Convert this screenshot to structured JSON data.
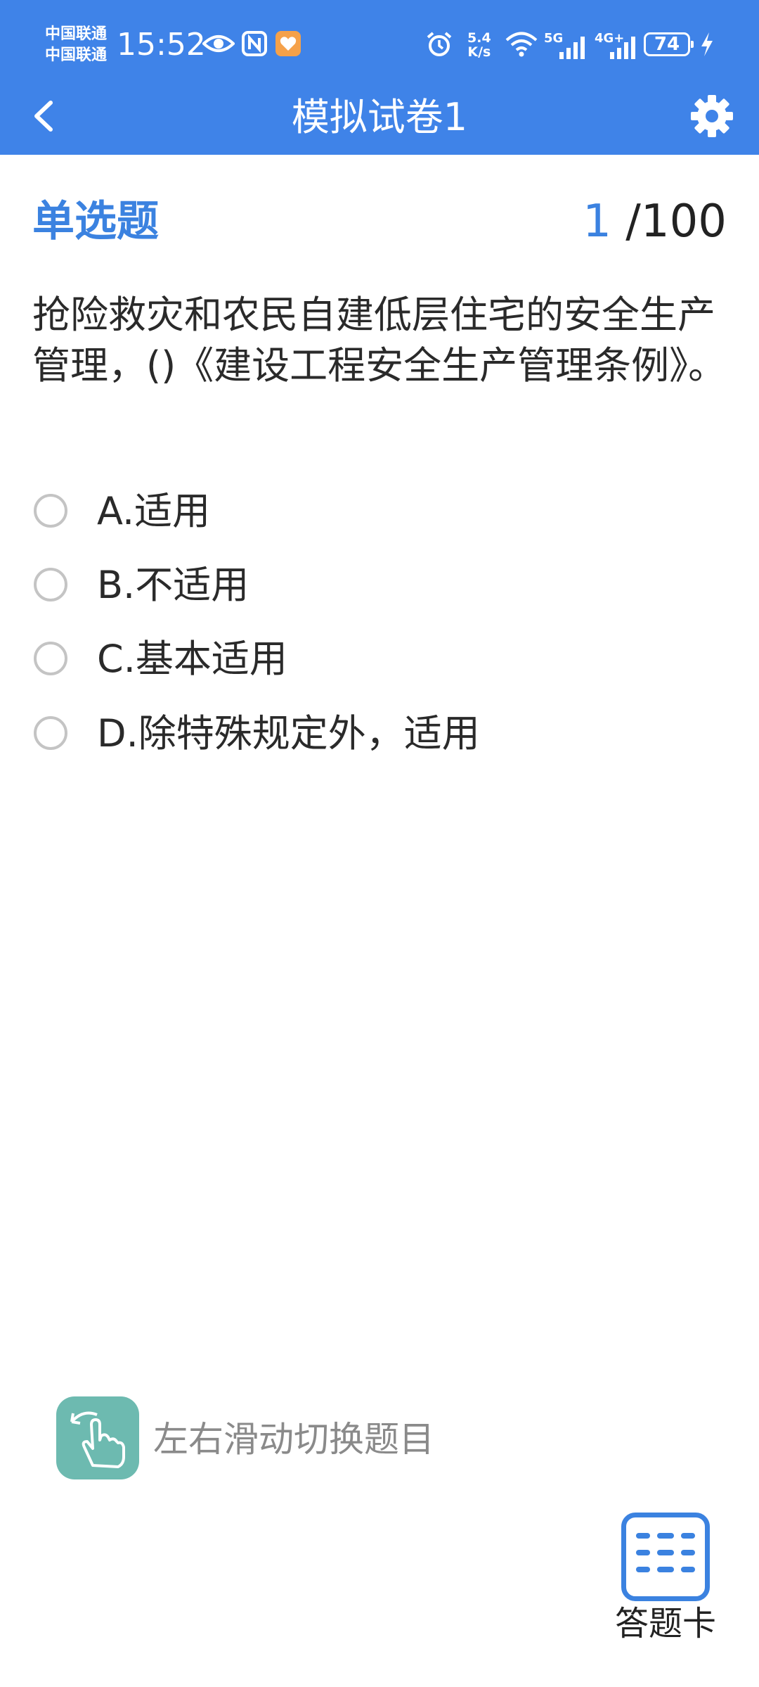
{
  "status_bar": {
    "carrier_1": "中国联通",
    "carrier_2": "中国联通",
    "time": "15:52",
    "net_speed_value": "5.4",
    "net_speed_unit": "K/s",
    "signal_1_label": "5G",
    "signal_2_label": "4G+",
    "battery": "74",
    "icons": [
      "eye-icon",
      "nfc-icon",
      "app-heart-icon",
      "alarm-icon",
      "wifi-icon",
      "signal-icon",
      "battery-icon",
      "charging-icon"
    ]
  },
  "header": {
    "title": "模拟试卷1",
    "back_icon": "chevron-left-icon",
    "settings_icon": "gear-icon"
  },
  "question": {
    "type": "单选题",
    "current": "1",
    "total": "/100",
    "stem": "抢险救灾和农民自建低层住宅的安全生产管理，()《建设工程安全生产管理条例》。",
    "options": [
      {
        "label": "A.适用"
      },
      {
        "label": "B.不适用"
      },
      {
        "label": "C.基本适用"
      },
      {
        "label": "D.除特殊规定外，适用"
      }
    ]
  },
  "swipe_hint": {
    "icon": "swipe-hand-icon",
    "text": "左右滑动切换题目"
  },
  "answer_card": {
    "icon": "grid-list-icon",
    "label": "答题卡"
  },
  "colors": {
    "topbar": "#3f83e8",
    "accent": "#3b82e0",
    "hint_icon_bg": "#6dbab0",
    "hint_text": "#8a8a8a"
  }
}
